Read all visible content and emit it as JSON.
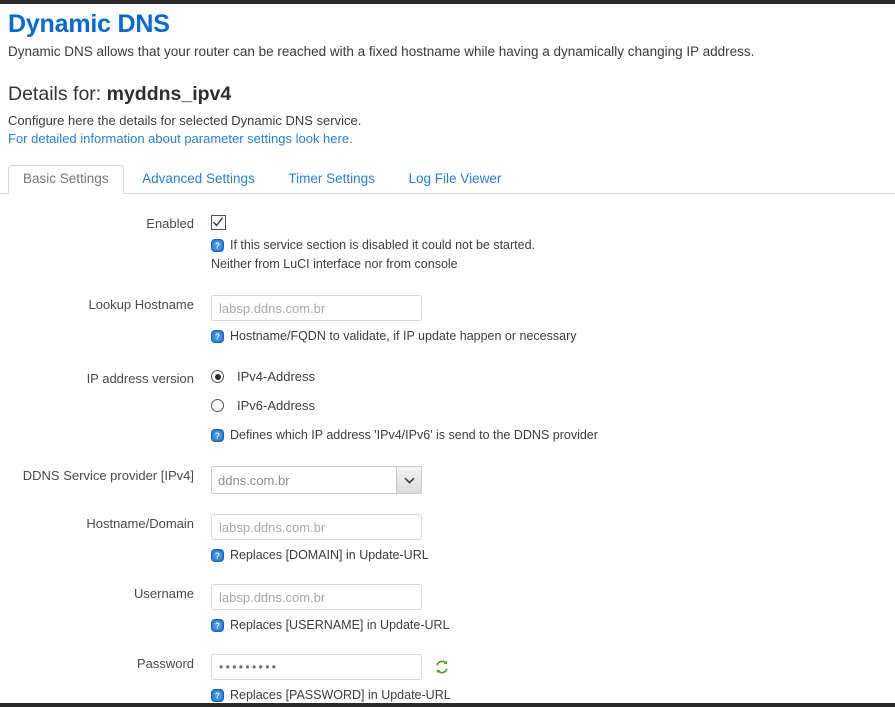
{
  "page": {
    "title": "Dynamic DNS",
    "intro": "Dynamic DNS allows that your router can be reached with a fixed hostname while having a dynamically changing IP address.",
    "details_prefix": "Details for: ",
    "details_name": "myddns_ipv4",
    "details_desc": "Configure here the details for selected Dynamic DNS service.",
    "doc_link": "For detailed information about parameter settings look here."
  },
  "tabs": [
    {
      "label": "Basic Settings",
      "active": true
    },
    {
      "label": "Advanced Settings",
      "active": false
    },
    {
      "label": "Timer Settings",
      "active": false
    },
    {
      "label": "Log File Viewer",
      "active": false
    }
  ],
  "form": {
    "enabled": {
      "label": "Enabled",
      "checked": true,
      "hint": "If this service section is disabled it could not be started.",
      "hint2": "Neither from LuCI interface nor from console"
    },
    "lookup_hostname": {
      "label": "Lookup Hostname",
      "value": "",
      "placeholder": "labsp.ddns.com.br",
      "hint": "Hostname/FQDN to validate, if IP update happen or necessary"
    },
    "ip_version": {
      "label": "IP address version",
      "options": [
        {
          "label": "IPv4-Address",
          "selected": true
        },
        {
          "label": "IPv6-Address",
          "selected": false
        }
      ],
      "hint": "Defines which IP address 'IPv4/IPv6' is send to the DDNS provider"
    },
    "service_provider": {
      "label": "DDNS Service provider [IPv4]",
      "selected": "ddns.com.br",
      "options": [
        "ddns.com.br"
      ]
    },
    "hostname_domain": {
      "label": "Hostname/Domain",
      "value": "",
      "placeholder": "labsp.ddns.com.br",
      "hint": "Replaces [DOMAIN] in Update-URL"
    },
    "username": {
      "label": "Username",
      "value": "",
      "placeholder": "labsp.ddns.com.br",
      "hint": "Replaces [USERNAME] in Update-URL"
    },
    "password": {
      "label": "Password",
      "value": "•••••••••",
      "hint": "Replaces [PASSWORD] in Update-URL",
      "reveal_icon": "refresh-icon"
    }
  },
  "colors": {
    "accent": "#0069d6",
    "link": "#2a7fdd",
    "help_icon": "#2a7fdd",
    "reveal_icon": "#5aa02c",
    "rule": "#2b2b2b"
  }
}
